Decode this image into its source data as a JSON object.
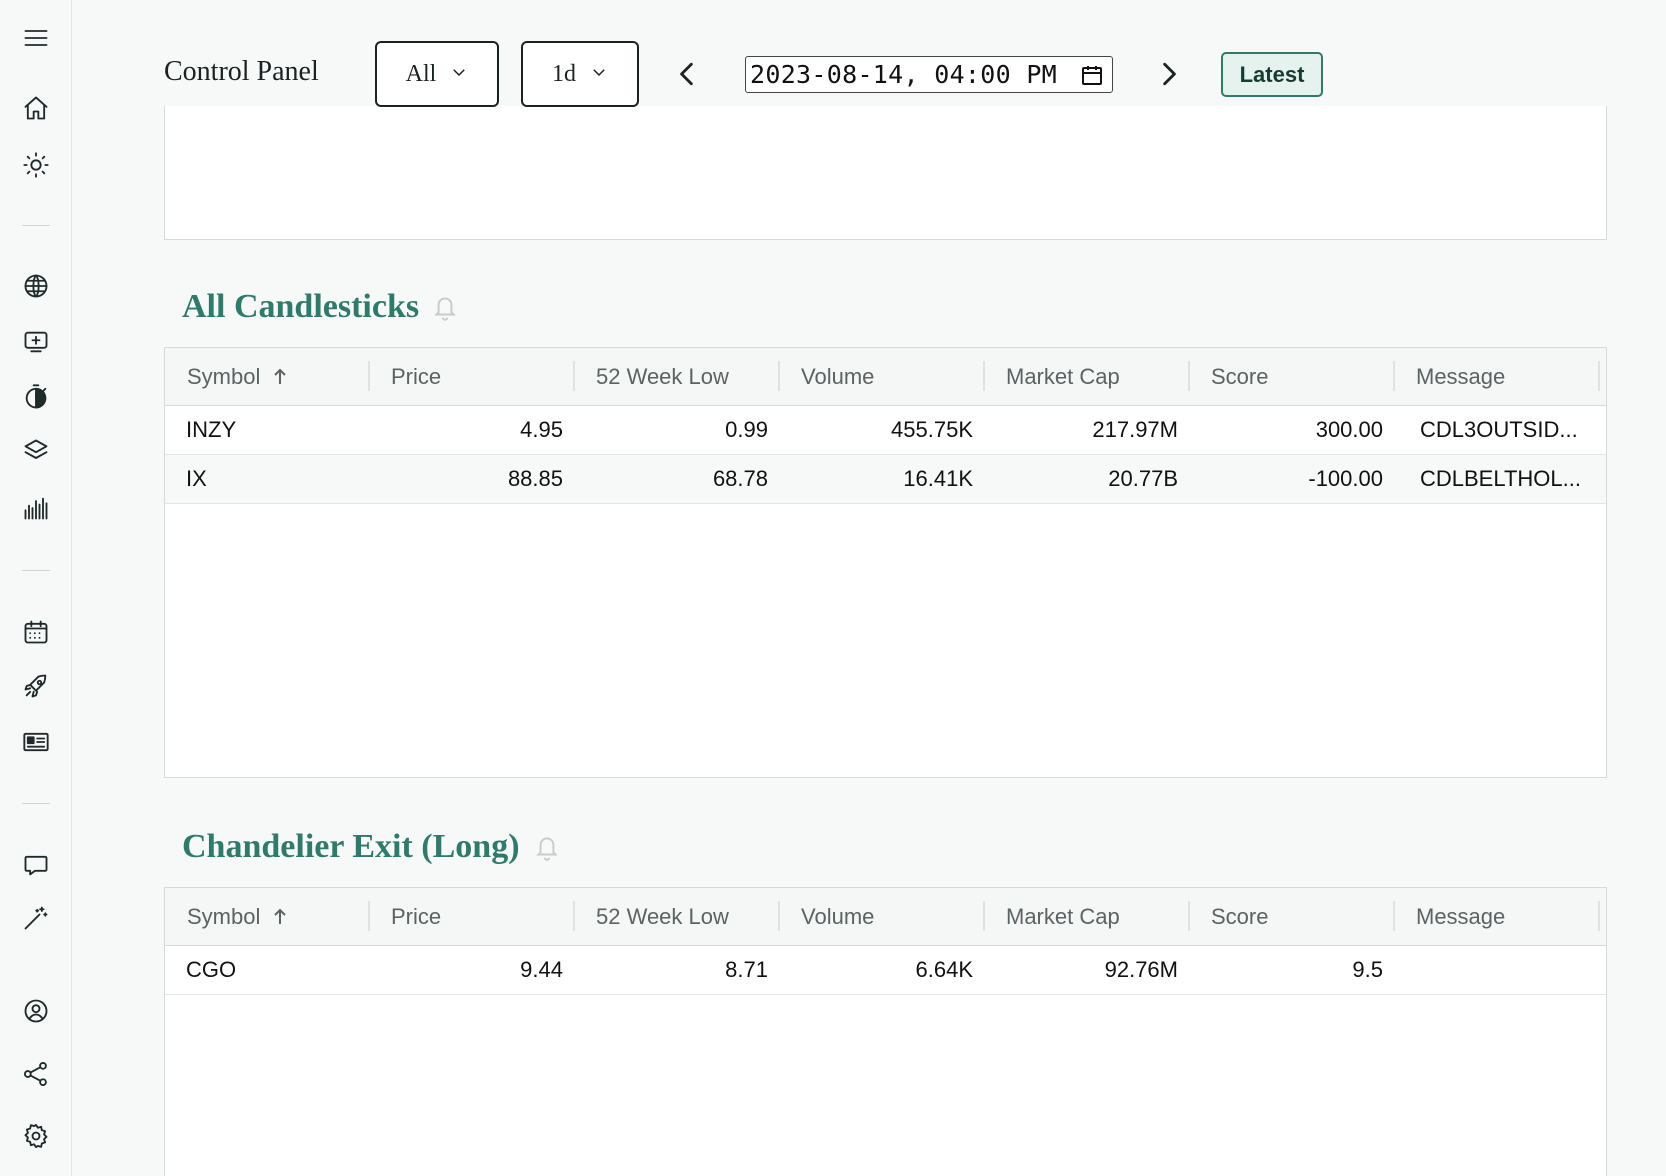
{
  "header": {
    "title": "Control Panel",
    "filter_value": "All",
    "interval_value": "1d",
    "datetime_value": "2023-08-14, 04:00 PM",
    "latest_label": "Latest"
  },
  "sidebar": {
    "icons": [
      "menu-icon",
      "home-icon",
      "sun-icon",
      "globe-icon",
      "add-display-icon",
      "stopwatch-icon",
      "layers-icon",
      "barcode-chart-icon",
      "calendar-icon",
      "rocket-icon",
      "newspaper-icon",
      "chat-icon",
      "magic-wand-icon",
      "user-circle-icon",
      "share-icon",
      "gear-icon"
    ]
  },
  "columns": [
    "Symbol",
    "Price",
    "52 Week Low",
    "Volume",
    "Market Cap",
    "Score",
    "Message"
  ],
  "sections": [
    {
      "title": "All Candlesticks",
      "rows": [
        {
          "symbol": "INZY",
          "price": "4.95",
          "low52": "0.99",
          "volume": "455.75K",
          "market_cap": "217.97M",
          "score": "300.00",
          "message": "CDL3OUTSID..."
        },
        {
          "symbol": "IX",
          "price": "88.85",
          "low52": "68.78",
          "volume": "16.41K",
          "market_cap": "20.77B",
          "score": "-100.00",
          "message": "CDLBELTHOL..."
        }
      ]
    },
    {
      "title": "Chandelier Exit (Long)",
      "rows": [
        {
          "symbol": "CGO",
          "price": "9.44",
          "low52": "8.71",
          "volume": "6.64K",
          "market_cap": "92.76M",
          "score": "9.5",
          "message": ""
        }
      ]
    }
  ]
}
